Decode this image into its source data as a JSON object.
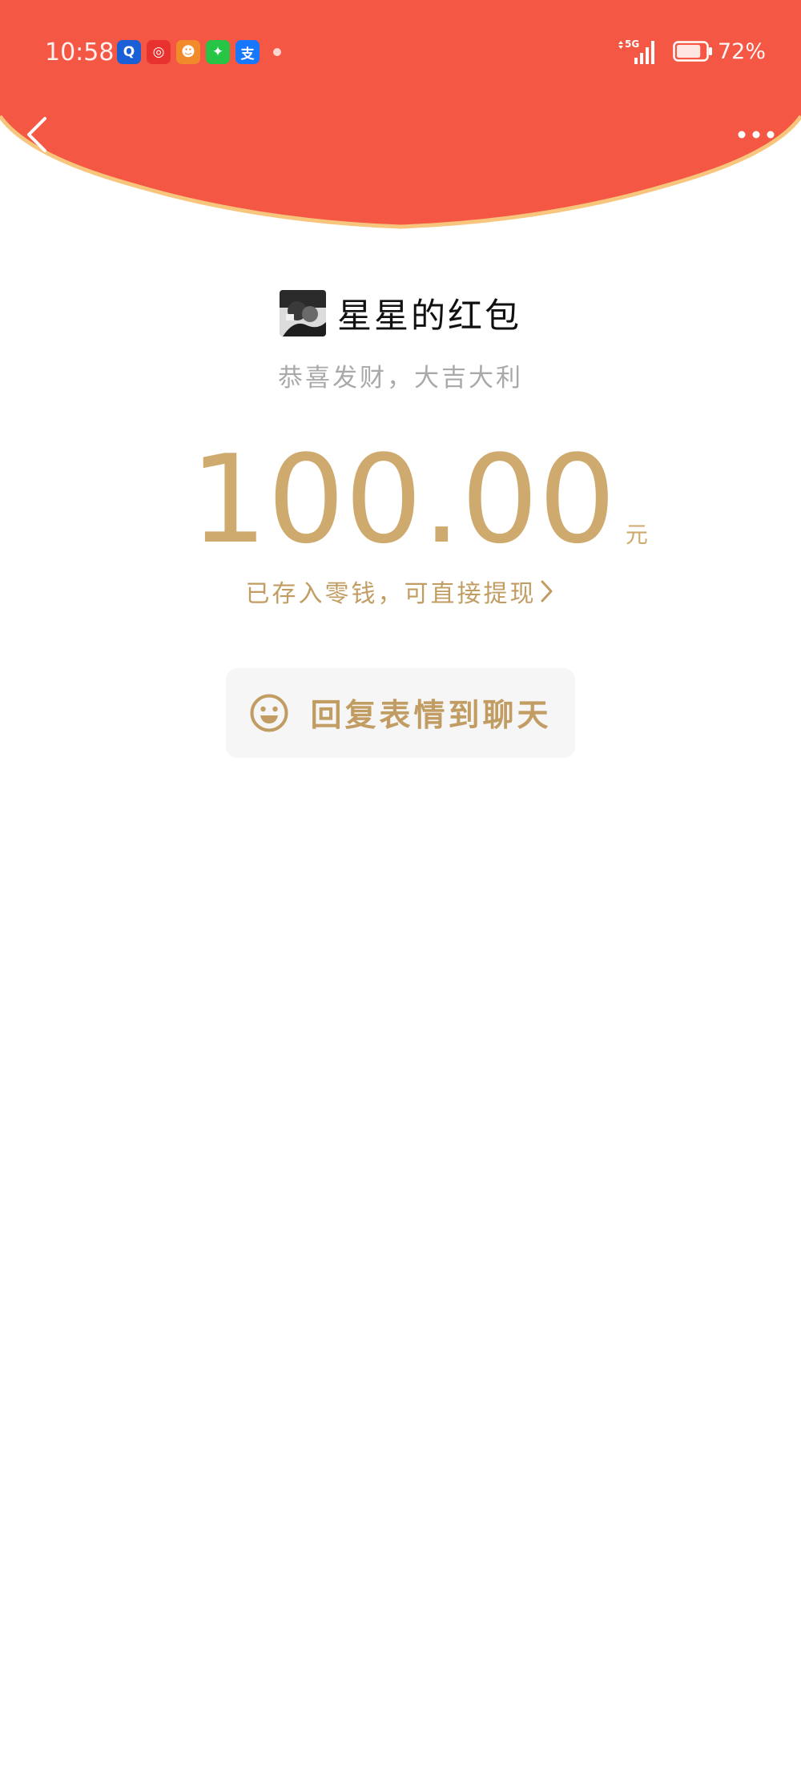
{
  "colors": {
    "header_red": "#f45744",
    "header_rim": "#f7c57c",
    "gold": "#cfaa6e",
    "gold_dark": "#c19d63",
    "greeting_gray": "#a9a9a9",
    "button_bg": "#f6f6f6"
  },
  "status_bar": {
    "time": "10:58",
    "network": "5G",
    "battery_percent": "72%",
    "battery_level": 0.72,
    "notification_icons": [
      {
        "name": "qq-browser-icon",
        "color": "#1a5fd6",
        "glyph": "Q"
      },
      {
        "name": "netease-music-icon",
        "color": "#e8322f",
        "glyph": "◎"
      },
      {
        "name": "game-center-icon",
        "color": "#f08a2b",
        "glyph": "☻"
      },
      {
        "name": "wechat-mini-icon",
        "color": "#28c445",
        "glyph": "✦"
      },
      {
        "name": "alipay-icon",
        "color": "#1677ff",
        "glyph": "支"
      }
    ]
  },
  "nav": {
    "back_icon": "chevron-left-icon",
    "more_icon": "more-dots-icon"
  },
  "envelope": {
    "sender_name": "星星的红包",
    "greeting": "恭喜发财，大吉大利",
    "amount": "100.00",
    "unit": "元",
    "deposit_note": "已存入零钱，可直接提现",
    "reply_button_label": "回复表情到聊天"
  }
}
